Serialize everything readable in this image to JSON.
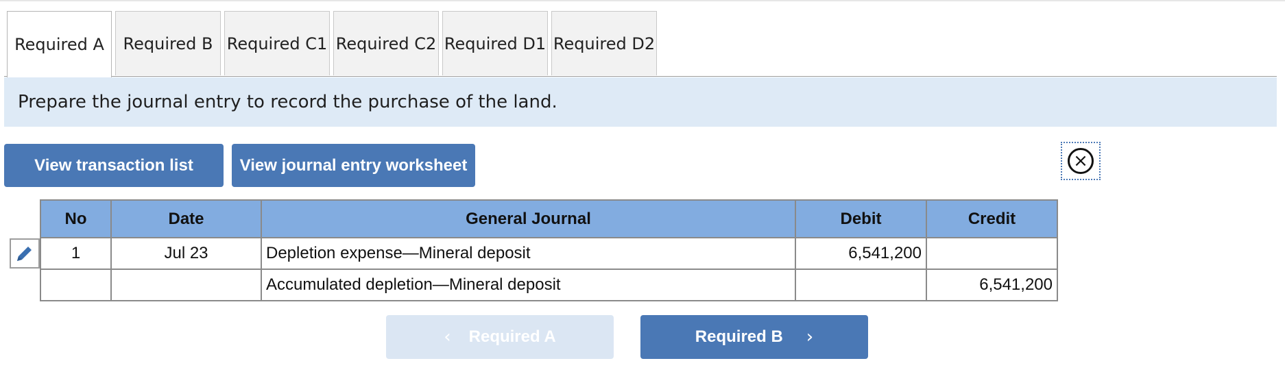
{
  "tabs": [
    {
      "label": "Required A",
      "active": true
    },
    {
      "label": "Required B",
      "active": false
    },
    {
      "label": "Required C1",
      "active": false
    },
    {
      "label": "Required C2",
      "active": false
    },
    {
      "label": "Required D1",
      "active": false
    },
    {
      "label": "Required D2",
      "active": false
    }
  ],
  "instruction": "Prepare the journal entry to record the purchase of the land.",
  "buttons": {
    "view_transactions": "View transaction list",
    "view_worksheet": "View journal entry worksheet"
  },
  "icons": {
    "close": "close-circle-icon",
    "edit": "pencil-icon",
    "prev": "chevron-left-icon",
    "next": "chevron-right-icon"
  },
  "journal": {
    "headers": {
      "no": "No",
      "date": "Date",
      "account": "General Journal",
      "debit": "Debit",
      "credit": "Credit"
    },
    "rows": [
      {
        "no": "1",
        "date": "Jul 23",
        "account": "Depletion expense—Mineral deposit",
        "debit": "6,541,200",
        "credit": ""
      },
      {
        "no": "",
        "date": "",
        "account": "Accumulated depletion—Mineral deposit",
        "debit": "",
        "credit": "6,541,200"
      }
    ]
  },
  "navigation": {
    "prev_label": "Required A",
    "next_label": "Required B",
    "prev_enabled": false
  },
  "colors": {
    "button_blue": "#4a78b5",
    "header_blue": "#82ace0",
    "instruction_bg": "#deeaf6",
    "disabled_button": "#dbe6f3"
  }
}
